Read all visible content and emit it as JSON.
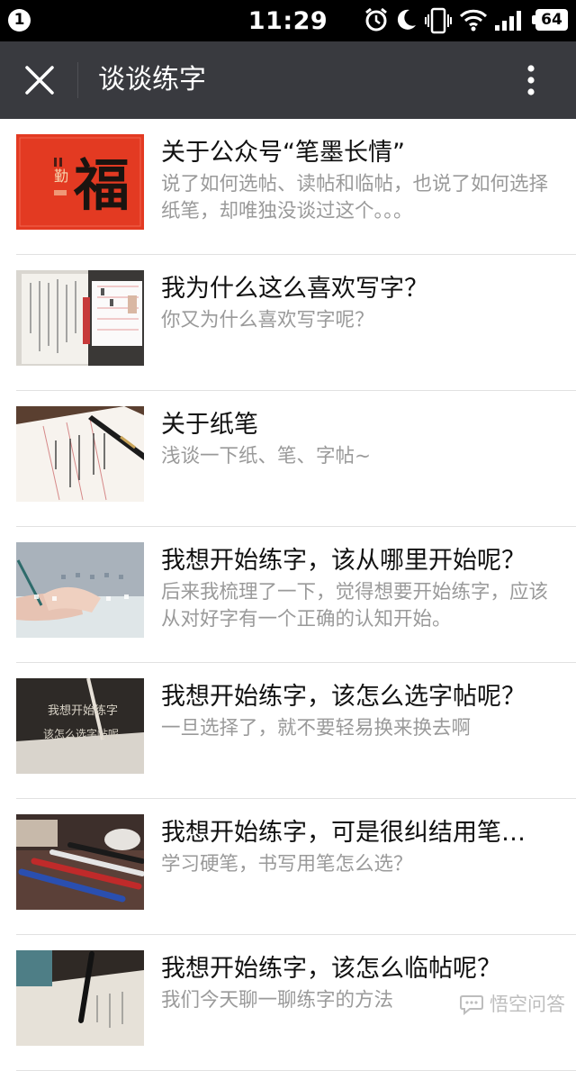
{
  "status_bar": {
    "notification_count": "1",
    "time": "11:29",
    "battery": "64",
    "icons": [
      "alarm-icon",
      "moon-icon",
      "vibrate-icon",
      "wifi-icon",
      "signal-icon",
      "battery-icon"
    ]
  },
  "nav": {
    "title": "谈谈练字",
    "close_icon": "close-icon",
    "more_icon": "more-vertical-icon",
    "background": "#393a3f"
  },
  "articles": [
    {
      "title": "关于公众号“笔墨长情”",
      "desc": "说了如何选帖、读帖和临帖，也说了如何选择纸笔，却唯独没谈过这个。。。"
    },
    {
      "title": "我为什么这么喜欢写字？",
      "desc": "你又为什么喜欢写字呢？"
    },
    {
      "title": "关于纸笔",
      "desc": "浅谈一下纸、笔、字帖~"
    },
    {
      "title": "我想开始练字，该从哪里开始呢？",
      "desc": "后来我梳理了一下，觉得想要开始练字，应该从对好字有一个正确的认知开始。"
    },
    {
      "title": "我想开始练字，该怎么选字帖呢？",
      "desc": "一旦选择了，就不要轻易换来换去啊"
    },
    {
      "title": "我想开始练字，可是很纠结用笔…",
      "desc": "学习硬笔，书写用笔怎么选？"
    },
    {
      "title": "我想开始练字，该怎么临帖呢？",
      "desc": "我们今天聊一聊练字的方法"
    }
  ],
  "thumbnails": {
    "t1": {
      "main": "福",
      "side": "勤"
    },
    "t5": {
      "line1": "我想开始练字",
      "line2": "该怎么选字帖呢"
    }
  },
  "watermark": {
    "text": "悟空问答"
  }
}
